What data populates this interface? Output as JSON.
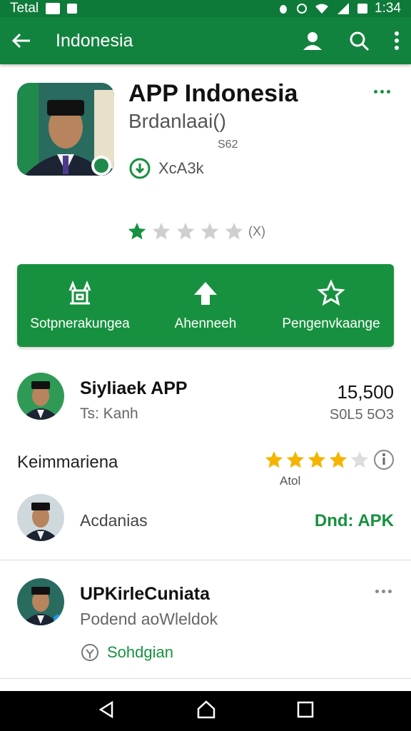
{
  "status": {
    "carrier": "Tetal",
    "time": "1:34"
  },
  "appbar": {
    "title": "Indonesia"
  },
  "app": {
    "title": "APP Indonesia",
    "subtitle": "Brdanlaai()",
    "tag": "S62",
    "downloads": "XcA3k",
    "rating_text": "(X)",
    "rating": 1
  },
  "actions": [
    {
      "label": "Sotpnerakungea",
      "icon": "castle-icon"
    },
    {
      "label": "Ahenneeh",
      "icon": "arrow-up-icon"
    },
    {
      "label": "Pengenvkaange",
      "icon": "star-outline-icon"
    }
  ],
  "item1": {
    "title": "Siyliaek APP",
    "subtitle": "Ts: Kanh",
    "price": "15,500",
    "price_sub": "S0L5 5O3"
  },
  "section": {
    "title": "Keimmariena",
    "rating_label": "Atol",
    "rating": 4
  },
  "item2": {
    "label": "Acdanias",
    "action": "Dnd: APK"
  },
  "item3": {
    "title": "UPKirleCuniata",
    "subtitle": "Podend aoWleldok",
    "status": "Sohdgian"
  },
  "colors": {
    "primary": "#12833f",
    "accent": "#17913f",
    "star": "#f4b400",
    "status_bar": "#0e7a3a"
  }
}
